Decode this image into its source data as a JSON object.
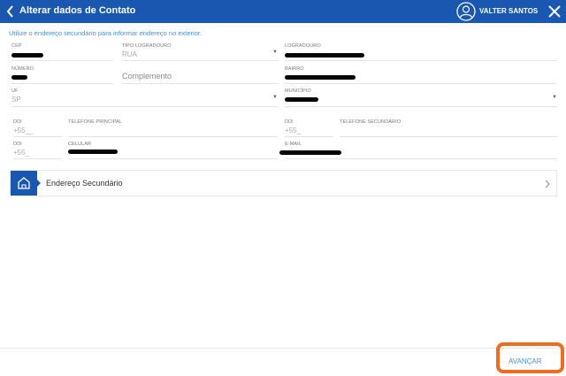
{
  "header": {
    "title": "Alterar dados de Contato",
    "user_name": "VALTER SANTOS"
  },
  "hint": "Utilize o endereço secundário para informar endereço no exterior.",
  "fields": {
    "cep": {
      "label": "CEP"
    },
    "tipo_logradouro": {
      "label": "TIPO LOGRADOURO",
      "value": "RUA"
    },
    "logradouro": {
      "label": "LOGRADOURO"
    },
    "numero": {
      "label": "NÚMERO"
    },
    "complemento": {
      "placeholder": "Complemento"
    },
    "bairro": {
      "label": "BAIRRO"
    },
    "uf": {
      "label": "UF",
      "value": "SP"
    },
    "municipio": {
      "label": "MUNICÍPIO"
    },
    "ddi_principal": {
      "label": "DDI",
      "value": "+55__"
    },
    "telefone_principal": {
      "label": "TELEFONE PRINCIPAL"
    },
    "ddi_secundario": {
      "label": "DDI",
      "value": "+55_"
    },
    "telefone_secundario": {
      "label": "TELEFONE SECUNDÁRIO"
    },
    "ddi_celular": {
      "label": "DDI",
      "value": "+55_"
    },
    "celular": {
      "label": "CELULAR"
    },
    "email": {
      "label": "E-MAIL"
    }
  },
  "secondary_address": {
    "label": "Endereço Secundário"
  },
  "footer": {
    "next_label": "AVANÇAR"
  },
  "colors": {
    "primary": "#1a57b0",
    "accent": "#4a90d9",
    "highlight": "#f26a1b"
  },
  "icons": {
    "back": "chevron-left-icon",
    "user": "user-circle-icon",
    "close": "close-icon",
    "home": "home-icon",
    "chevron": "chevron-right-icon"
  }
}
